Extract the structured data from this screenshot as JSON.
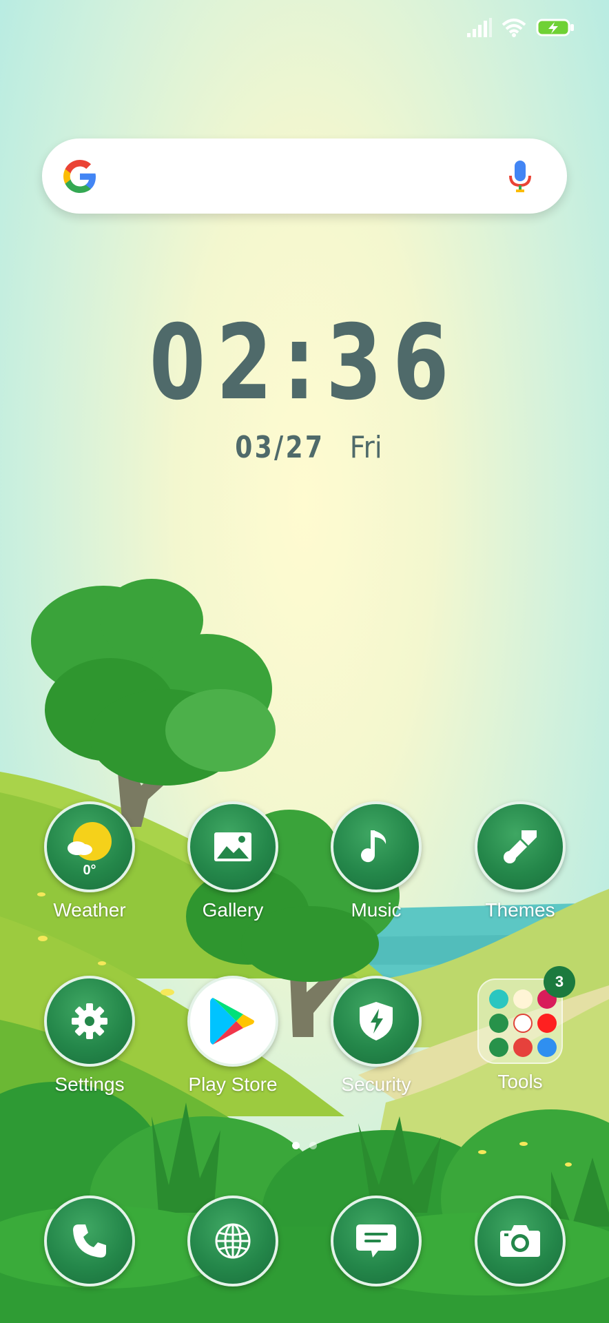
{
  "status_bar": {
    "signal_icon": "signal-icon",
    "wifi_icon": "wifi-icon",
    "battery_icon": "battery-charging-icon"
  },
  "search_bar": {
    "logo_icon": "google-logo-icon",
    "mic_icon": "microphone-icon"
  },
  "clock": {
    "time": "02:36",
    "date": "03/27",
    "day": "Fri"
  },
  "apps": [
    {
      "label": "Weather",
      "icon": "weather-sun-icon",
      "temp": "0°"
    },
    {
      "label": "Gallery",
      "icon": "gallery-icon"
    },
    {
      "label": "Music",
      "icon": "music-note-icon"
    },
    {
      "label": "Themes",
      "icon": "paintbrush-icon"
    },
    {
      "label": "Settings",
      "icon": "gear-icon"
    },
    {
      "label": "Play Store",
      "icon": "play-store-icon"
    },
    {
      "label": "Security",
      "icon": "shield-icon"
    },
    {
      "label": "Tools",
      "icon": "folder-icon",
      "badge": "3"
    }
  ],
  "dock": [
    {
      "icon": "phone-icon"
    },
    {
      "icon": "browser-globe-icon"
    },
    {
      "icon": "messages-icon"
    },
    {
      "icon": "camera-icon"
    }
  ],
  "page_indicator": {
    "pages": 2,
    "current": 1
  },
  "colors": {
    "icon_green": "#24874a",
    "clock_text": "#4f6a6a"
  }
}
